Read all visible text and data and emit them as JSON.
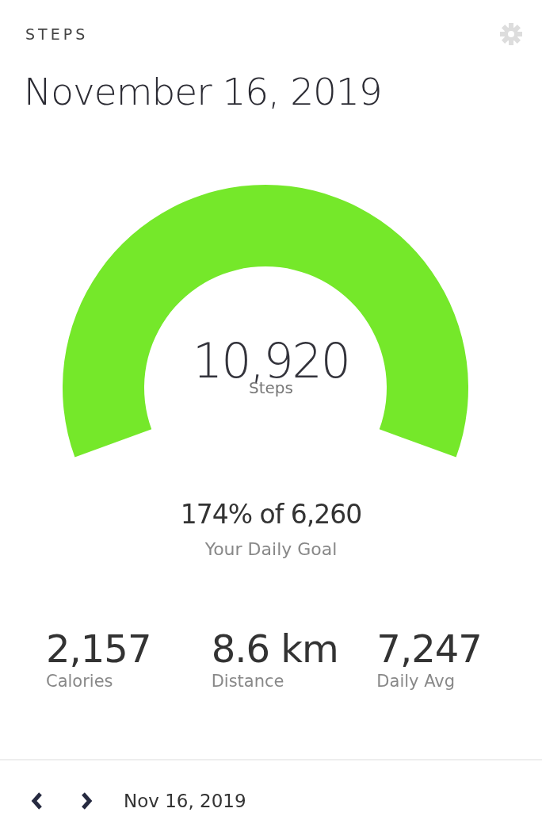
{
  "header": {
    "title": "STEPS",
    "date": "November 16, 2019"
  },
  "gauge": {
    "value": "10,920",
    "unit": "Steps"
  },
  "goal": {
    "text": "174% of 6,260",
    "caption": "Your Daily Goal"
  },
  "stats": [
    {
      "value": "2,157",
      "label": "Calories"
    },
    {
      "value": "8.6 km",
      "label": "Distance"
    },
    {
      "value": "7,247",
      "label": "Daily Avg"
    }
  ],
  "footer": {
    "date": "Nov 16, 2019"
  }
}
